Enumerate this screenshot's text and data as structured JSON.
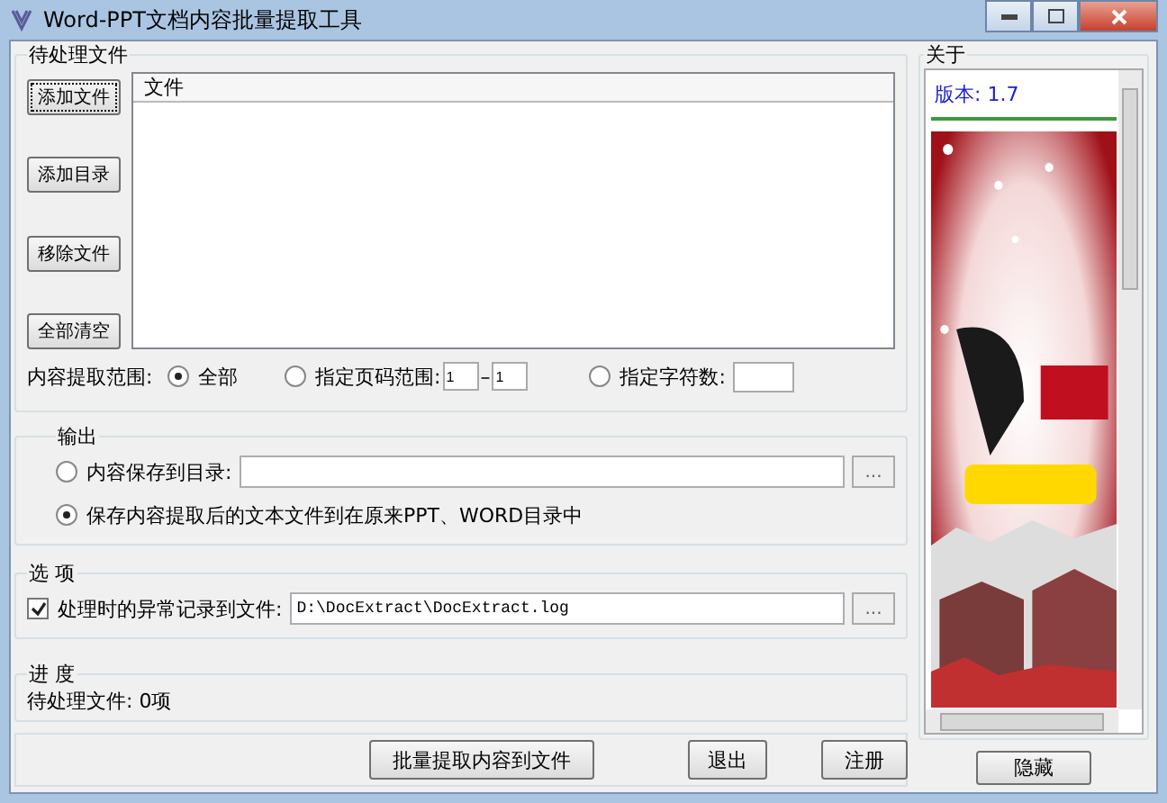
{
  "window": {
    "title": "Word-PPT文档内容批量提取工具"
  },
  "files": {
    "title": "待处理文件",
    "buttons": [
      "添加文件",
      "添加目录",
      "移除文件",
      "全部清空"
    ],
    "list_column": "文件",
    "range": {
      "label": "内容提取范围:",
      "options": [
        {
          "label": "全部",
          "selected": true,
          "kind": "plain"
        },
        {
          "label": "指定页码范围:",
          "selected": false,
          "kind": "pages"
        },
        {
          "label": "指定字符数:",
          "selected": false,
          "kind": "chars"
        }
      ],
      "page_from": "1",
      "dash": "–",
      "page_to": "1"
    }
  },
  "output": {
    "title": "输出",
    "options": [
      {
        "label": "内容保存到目录:",
        "selected": false,
        "kind": "path"
      },
      {
        "label": "保存内容提取后的文本文件到在原来PPT、WORD目录中",
        "selected": true,
        "kind": "plain"
      }
    ],
    "browse": "..."
  },
  "options": {
    "title": "选 项",
    "log_label": "处理时的异常记录到文件:",
    "log_checked": true,
    "log_path": "D:\\DocExtract\\DocExtract.log",
    "browse": "..."
  },
  "progress": {
    "title": "进 度",
    "status": "待处理文件: 0项"
  },
  "actions": [
    "批量提取内容到文件",
    "退出",
    "注册"
  ],
  "about": {
    "title": "关于",
    "version": "版本: 1.7",
    "hide": "隐藏"
  }
}
